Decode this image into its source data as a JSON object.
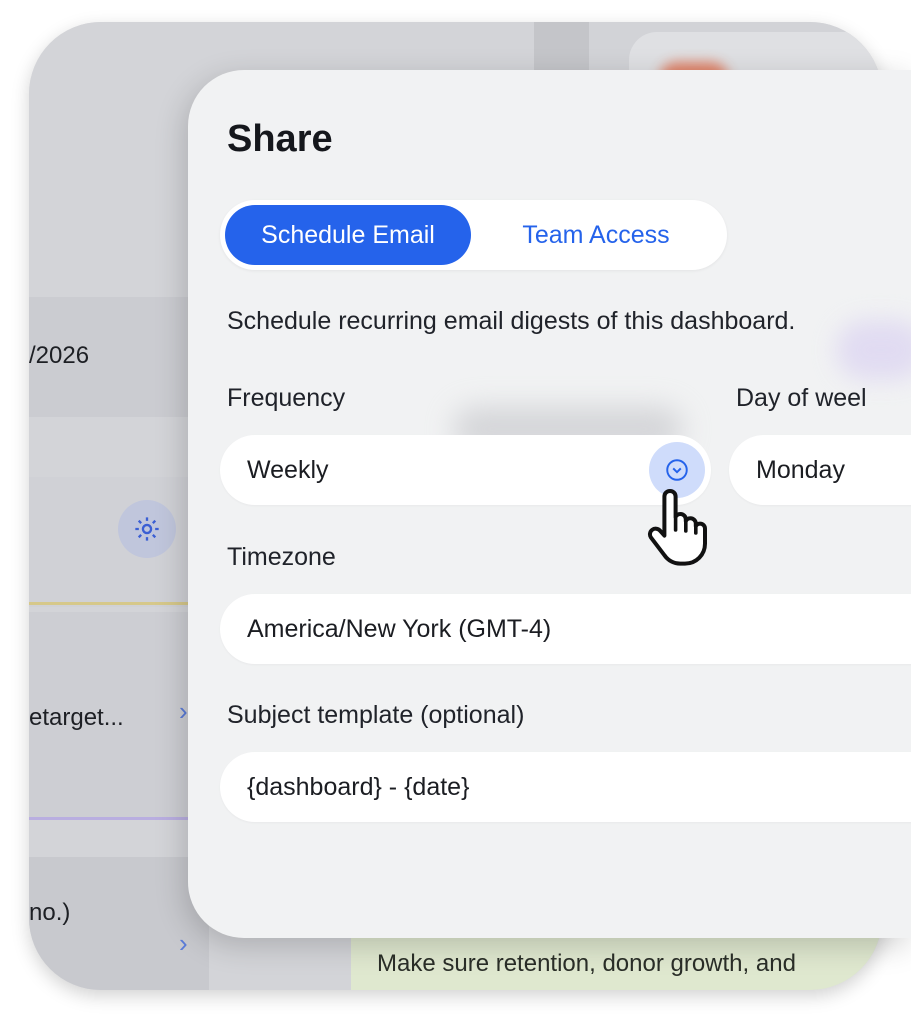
{
  "background": {
    "date_fragment": "/2026",
    "row_text_1": "etarget...",
    "row_text_2": "no.)",
    "footer_text": "Make sure retention, donor growth, and",
    "gear_icon": "gear-icon",
    "chevron_icon": "chevron-right-icon"
  },
  "modal": {
    "title": "Share",
    "tabs": [
      {
        "label": "Schedule Email",
        "active": true
      },
      {
        "label": "Team Access",
        "active": false
      }
    ],
    "description": "Schedule recurring email digests of this dashboard.",
    "frequency": {
      "label": "Frequency",
      "value": "Weekly"
    },
    "day_of_week": {
      "label": "Day of weel",
      "value": "Monday"
    },
    "timezone": {
      "label": "Timezone",
      "value": "America/New York (GMT-4)"
    },
    "subject": {
      "label": "Subject template (optional)",
      "value": "{dashboard} - {date}"
    }
  },
  "colors": {
    "accent": "#2563eb",
    "accent_soft": "#cfdcfb",
    "modal_bg": "#f1f2f3"
  }
}
